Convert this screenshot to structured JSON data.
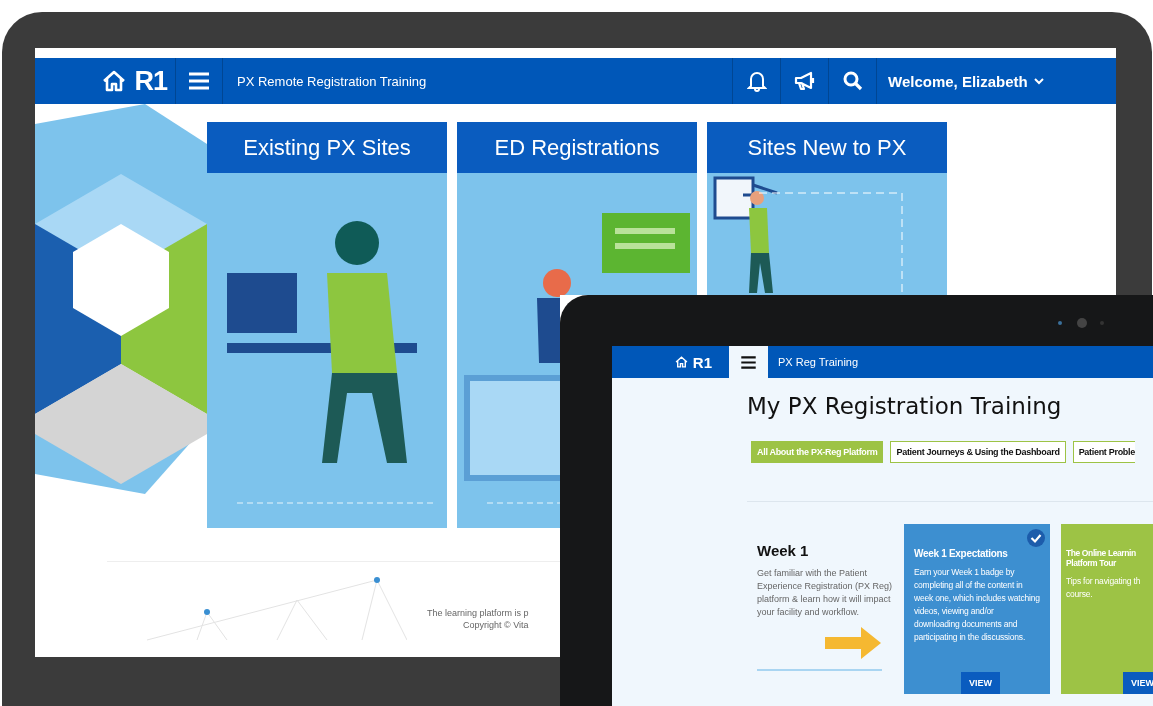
{
  "laptop": {
    "nav": {
      "logo": "R1",
      "title": "PX Remote Registration Training",
      "welcome": "Welcome, Elizabeth"
    },
    "tiles": [
      {
        "title": "Existing PX Sites"
      },
      {
        "title": "ED Registrations"
      },
      {
        "title": "Sites New to PX"
      }
    ],
    "footer": [
      "The learning platform is p",
      "Copyright © Vita"
    ]
  },
  "tablet": {
    "nav": {
      "logo": "R1",
      "title": "PX Reg Training"
    },
    "heading": "My PX Registration Training",
    "tabs": [
      {
        "label": "All About the PX-Reg Platform",
        "selected": true
      },
      {
        "label": "Patient Journeys & Using the Dashboard",
        "selected": false
      },
      {
        "label": "Patient Proble",
        "selected": false
      }
    ],
    "week": {
      "title": "Week 1",
      "text": "Get familiar with the Patient Experience Registration (PX Reg) platform & learn how it will impact your facility and workflow."
    },
    "cards": [
      {
        "title": "Week 1 Expectations",
        "text": "Earn your Week 1 badge by completing all of the content in week one, which includes watching videos, viewing and/or downloading documents and participating in the discussions.",
        "completed": true,
        "color": "#3d8fd0",
        "button": "VIEW"
      },
      {
        "title": "The Online Learnin\nPlatform Tour",
        "text": "Tips for navigating th\ncourse.",
        "completed": false,
        "color": "#9dc345",
        "button": "VIEW"
      }
    ]
  }
}
